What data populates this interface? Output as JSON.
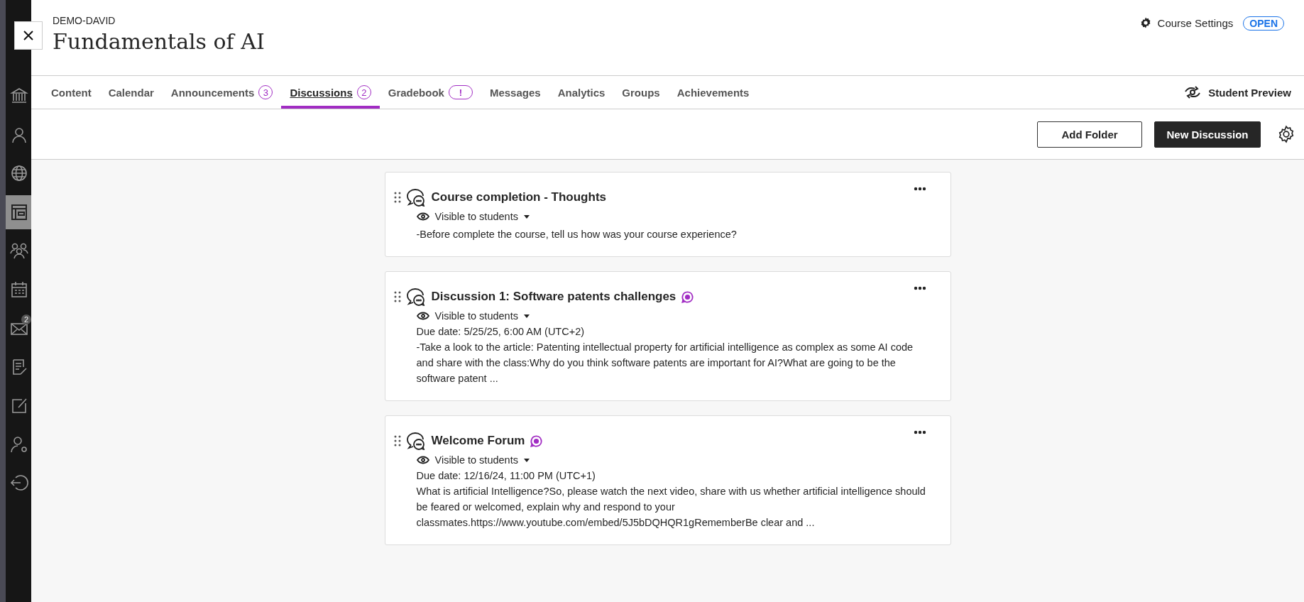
{
  "sidebar": {
    "items": [
      {
        "kind": "institution",
        "selected": false
      },
      {
        "kind": "person",
        "selected": false
      },
      {
        "kind": "globe",
        "selected": false
      },
      {
        "kind": "courses",
        "selected": true
      },
      {
        "kind": "groups",
        "selected": false
      },
      {
        "kind": "calendar",
        "selected": false
      },
      {
        "kind": "mail",
        "selected": false,
        "badge": "2"
      },
      {
        "kind": "document",
        "selected": false
      },
      {
        "kind": "edit",
        "selected": false
      },
      {
        "kind": "user-gear",
        "selected": false
      },
      {
        "kind": "signout",
        "selected": false
      }
    ]
  },
  "header": {
    "course_code": "DEMO-DAVID",
    "title": "Fundamentals of AI",
    "settings_label": "Course Settings",
    "status": "OPEN"
  },
  "tabs": [
    {
      "label": "Content",
      "selected": false
    },
    {
      "label": "Calendar",
      "selected": false
    },
    {
      "label": "Announcements",
      "selected": false,
      "badge": "3"
    },
    {
      "label": "Discussions",
      "selected": true,
      "badge": "2"
    },
    {
      "label": "Gradebook",
      "selected": false,
      "badge": "!"
    },
    {
      "label": "Messages",
      "selected": false
    },
    {
      "label": "Analytics",
      "selected": false
    },
    {
      "label": "Groups",
      "selected": false
    },
    {
      "label": "Achievements",
      "selected": false
    }
  ],
  "student_preview": "Student Preview",
  "toolbar": {
    "buttons": [
      {
        "label": "Add Folder",
        "kind": "secondary"
      },
      {
        "label": "New Discussion",
        "kind": "primary"
      }
    ]
  },
  "discussions": [
    {
      "title": "Course completion - Thoughts",
      "graded": false,
      "visibility": "Visible to students",
      "description": "-Before complete the course, tell us how was your course experience?"
    },
    {
      "title": "Discussion 1: Software patents challenges",
      "graded": true,
      "visibility": "Visible to students",
      "due": "Due date: 5/25/25, 6:00 AM (UTC+2)",
      "description": "-Take a look to the article: Patenting intellectual property for artificial intelligence as complex as some AI code and share with the class:Why do you think software patents are important for AI?What are going to be the software patent ..."
    },
    {
      "title": "Welcome Forum",
      "graded": true,
      "visibility": "Visible to students",
      "due": "Due date: 12/16/24, 11:00 PM (UTC+1)",
      "description": "What is artificial Intelligence?So, please watch the next video, share with us whether artificial intelligence should be feared or welcomed, explain why and respond to your classmates.https://www.youtube.com/embed/5J5bDQHQR1gRememberBe clear and ..."
    }
  ]
}
